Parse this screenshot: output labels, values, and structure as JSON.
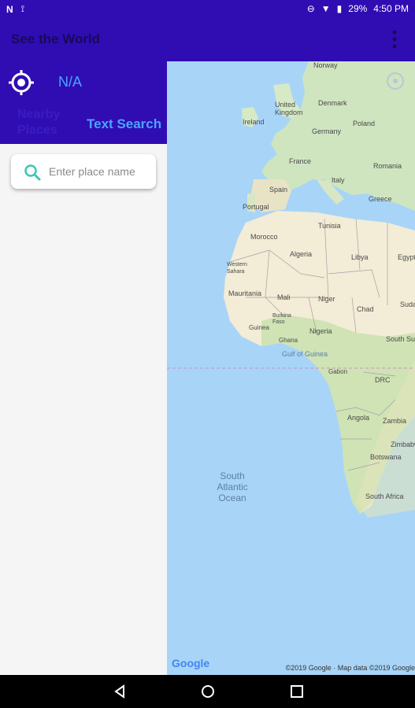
{
  "status_bar": {
    "battery": "29%",
    "time": "4:50 PM",
    "left_icons": [
      "n-icon",
      "usb-icon"
    ],
    "right_icons": [
      "dnd-icon",
      "wifi-icon",
      "battery-icon"
    ]
  },
  "app_bar": {
    "title": "See the World",
    "menu_icon": "more-vert-icon",
    "bg_color": "#2f0db3"
  },
  "panel": {
    "location_icon": "my-location-icon",
    "location_text": "N/A",
    "tabs": [
      {
        "label": "Nearby Places",
        "selected": false
      },
      {
        "label": "Text Search",
        "selected": true
      }
    ],
    "search": {
      "icon": "search-icon",
      "placeholder": "Enter place name"
    }
  },
  "map": {
    "countries": [
      "Norway",
      "United Kingdom",
      "Denmark",
      "Ireland",
      "Germany",
      "Poland",
      "France",
      "Romania",
      "Spain",
      "Italy",
      "Portugal",
      "Greece",
      "Tunisia",
      "Morocco",
      "Algeria",
      "Libya",
      "Egypt",
      "Western Sahara",
      "Mauritania",
      "Mali",
      "Niger",
      "Chad",
      "Sudan",
      "Burkina Faso",
      "Guinea",
      "Nigeria",
      "Ghana",
      "South Sudan",
      "Gabon",
      "DRC",
      "Angola",
      "Zambia",
      "Zimbabwe",
      "Botswana",
      "South Africa"
    ],
    "water_labels": {
      "ocean": "South Atlantic Ocean",
      "gulf": "Gulf of Guinea"
    },
    "logo": "Google",
    "attribution": "©2019 Google · Map data ©2019 Google"
  },
  "nav_bar": {
    "buttons": [
      "back-icon",
      "home-icon",
      "recents-icon"
    ]
  }
}
